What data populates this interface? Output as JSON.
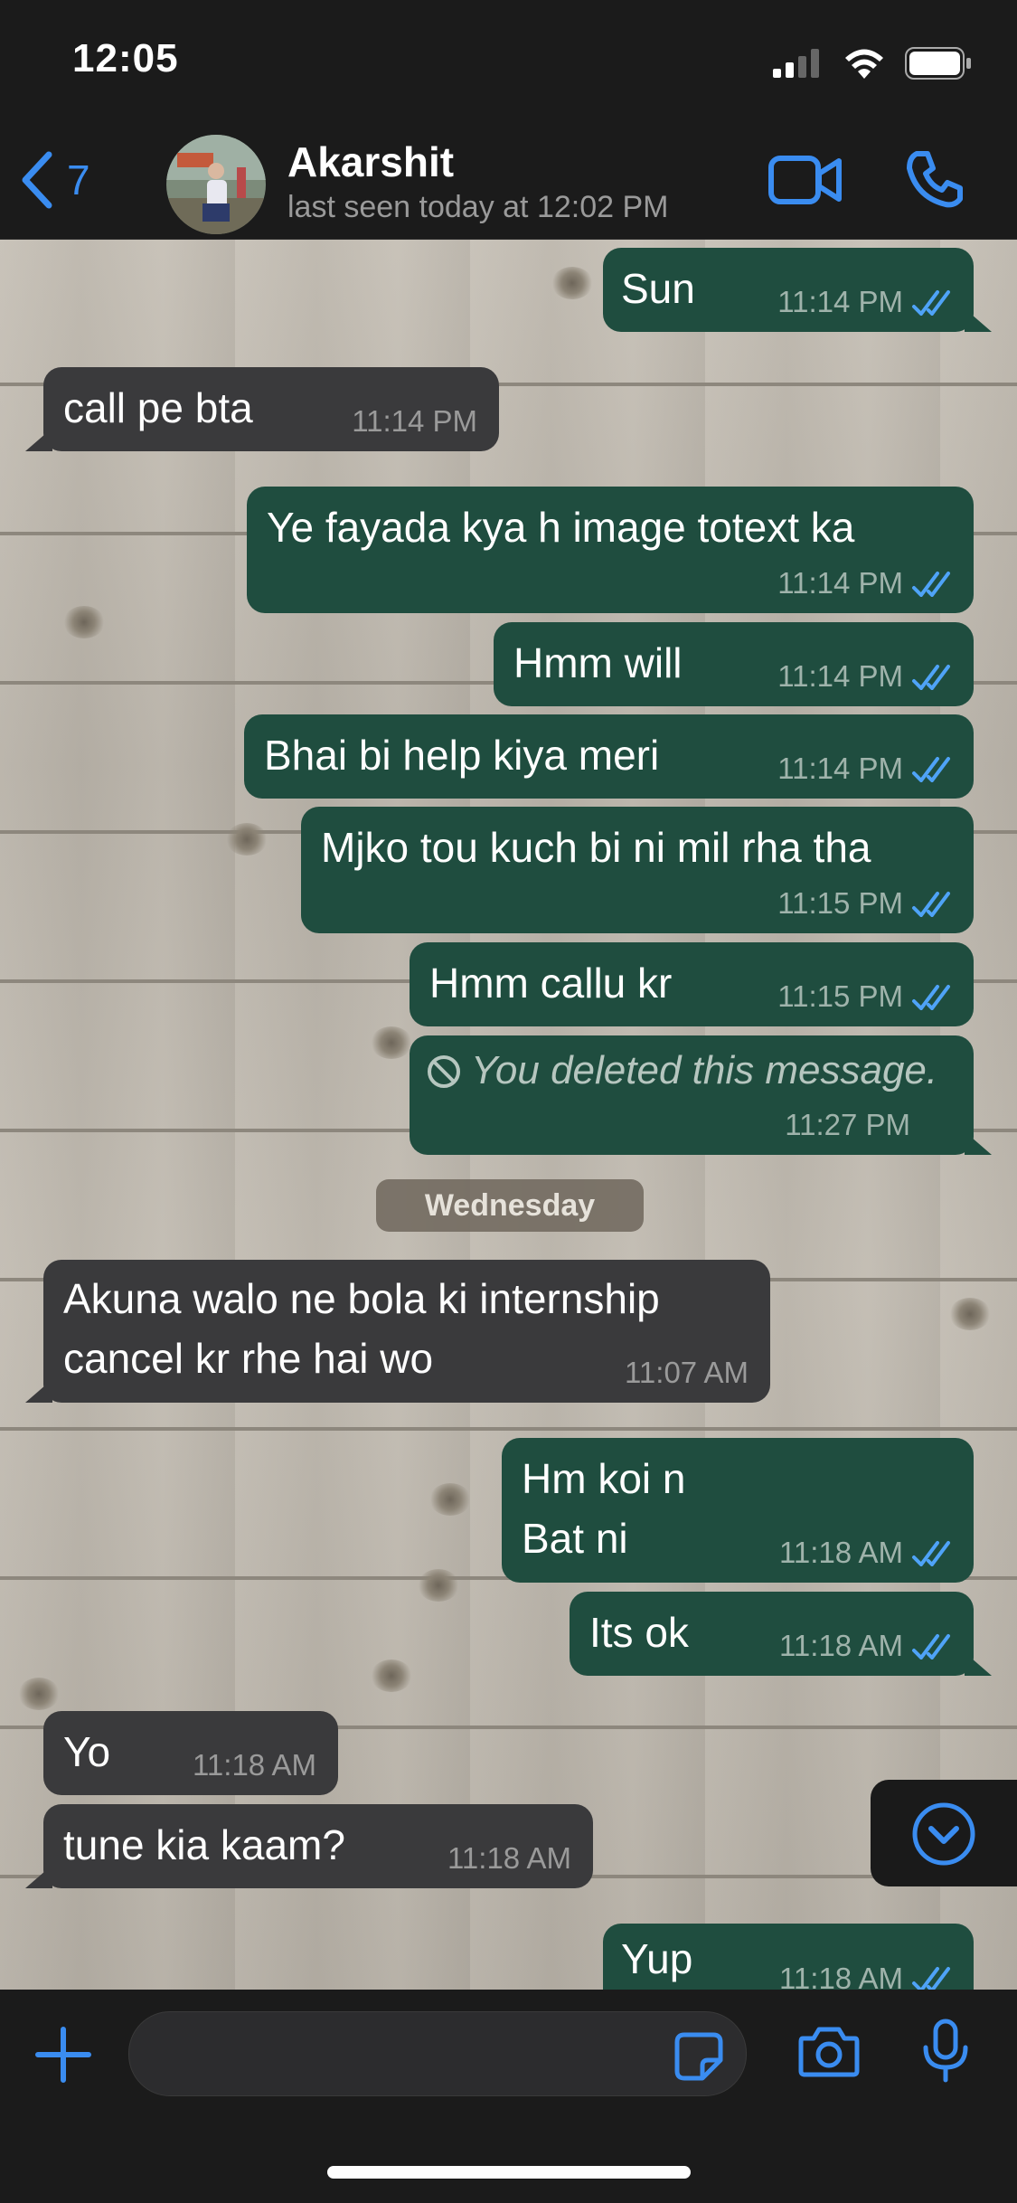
{
  "status_bar": {
    "time": "12:05"
  },
  "header": {
    "back_count": "7",
    "contact_name": "Akarshit",
    "last_seen": "last seen today at 12:02 PM"
  },
  "messages": [
    {
      "direction": "out",
      "text": "Sun",
      "time": "11:14 PM",
      "read": true
    },
    {
      "direction": "in",
      "text": "call pe bta",
      "time": "11:14 PM"
    },
    {
      "direction": "out",
      "text": "Ye fayada kya h image totext ka",
      "time": "11:14 PM",
      "read": true
    },
    {
      "direction": "out",
      "text": "Hmm will",
      "time": "11:14 PM",
      "read": true
    },
    {
      "direction": "out",
      "text": "Bhai bi help kiya meri",
      "time": "11:14 PM",
      "read": true
    },
    {
      "direction": "out",
      "text": "Mjko tou kuch bi ni mil rha tha",
      "time": "11:15 PM",
      "read": true
    },
    {
      "direction": "out",
      "text": "Hmm callu kr",
      "time": "11:15 PM",
      "read": true
    },
    {
      "direction": "out",
      "text": "You deleted this message.",
      "time": "11:27 PM",
      "deleted": true
    },
    {
      "direction": "in",
      "text_line1": "Akuna walo ne bola ki internship",
      "text_line2": "cancel kr rhe hai wo",
      "time": "11:07 AM"
    },
    {
      "direction": "out",
      "text_line1": "Hm koi n",
      "text_line2": "Bat ni",
      "time": "11:18 AM",
      "read": true
    },
    {
      "direction": "out",
      "text": "Its ok",
      "time": "11:18 AM",
      "read": true
    },
    {
      "direction": "in",
      "text": "Yo",
      "time": "11:18 AM"
    },
    {
      "direction": "in",
      "text": "tune kia kaam?",
      "time": "11:18 AM"
    },
    {
      "direction": "out",
      "text": "Yup",
      "time": "11:18 AM",
      "read": true
    }
  ],
  "date_separator": "Wednesday",
  "colors": {
    "accent": "#3a8cf0",
    "outgoing_bubble": "#1f4d3f",
    "incoming_bubble": "#3a3a3c",
    "read_ticks": "#4fa3f7"
  },
  "icons": [
    "back-chevron-icon",
    "video-call-icon",
    "phone-icon",
    "ticks-icon",
    "deleted-icon",
    "chevron-down-icon",
    "plus-icon",
    "sticker-icon",
    "camera-icon",
    "microphone-icon",
    "signal-icon",
    "wifi-icon",
    "battery-icon"
  ]
}
